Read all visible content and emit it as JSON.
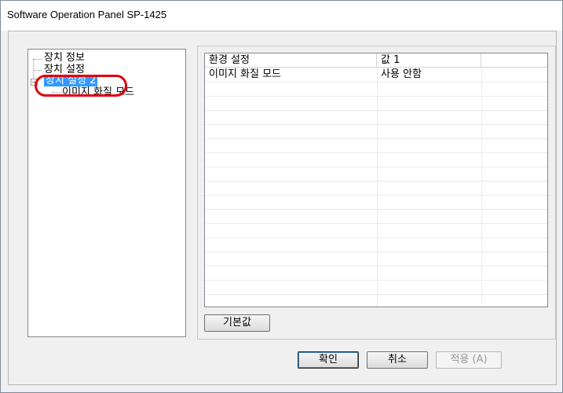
{
  "window": {
    "title": "Software Operation Panel SP-1425"
  },
  "tree": {
    "items": [
      {
        "label": "장치 정보"
      },
      {
        "label": "장치 설정"
      },
      {
        "label": "장치 설정 2"
      },
      {
        "label": "이미지 화질 모드"
      }
    ],
    "expander": "−",
    "highlight_color": "#e0000b",
    "selected_color": "#3399ff"
  },
  "list": {
    "columns": [
      "환경 설정",
      "값 1",
      ""
    ],
    "rows": [
      {
        "setting": "이미지 화질 모드",
        "value": "사용 안함"
      }
    ]
  },
  "buttons": {
    "default_label": "기본값",
    "ok_label": "확인",
    "cancel_label": "취소",
    "apply_label": "적용 (A)"
  }
}
